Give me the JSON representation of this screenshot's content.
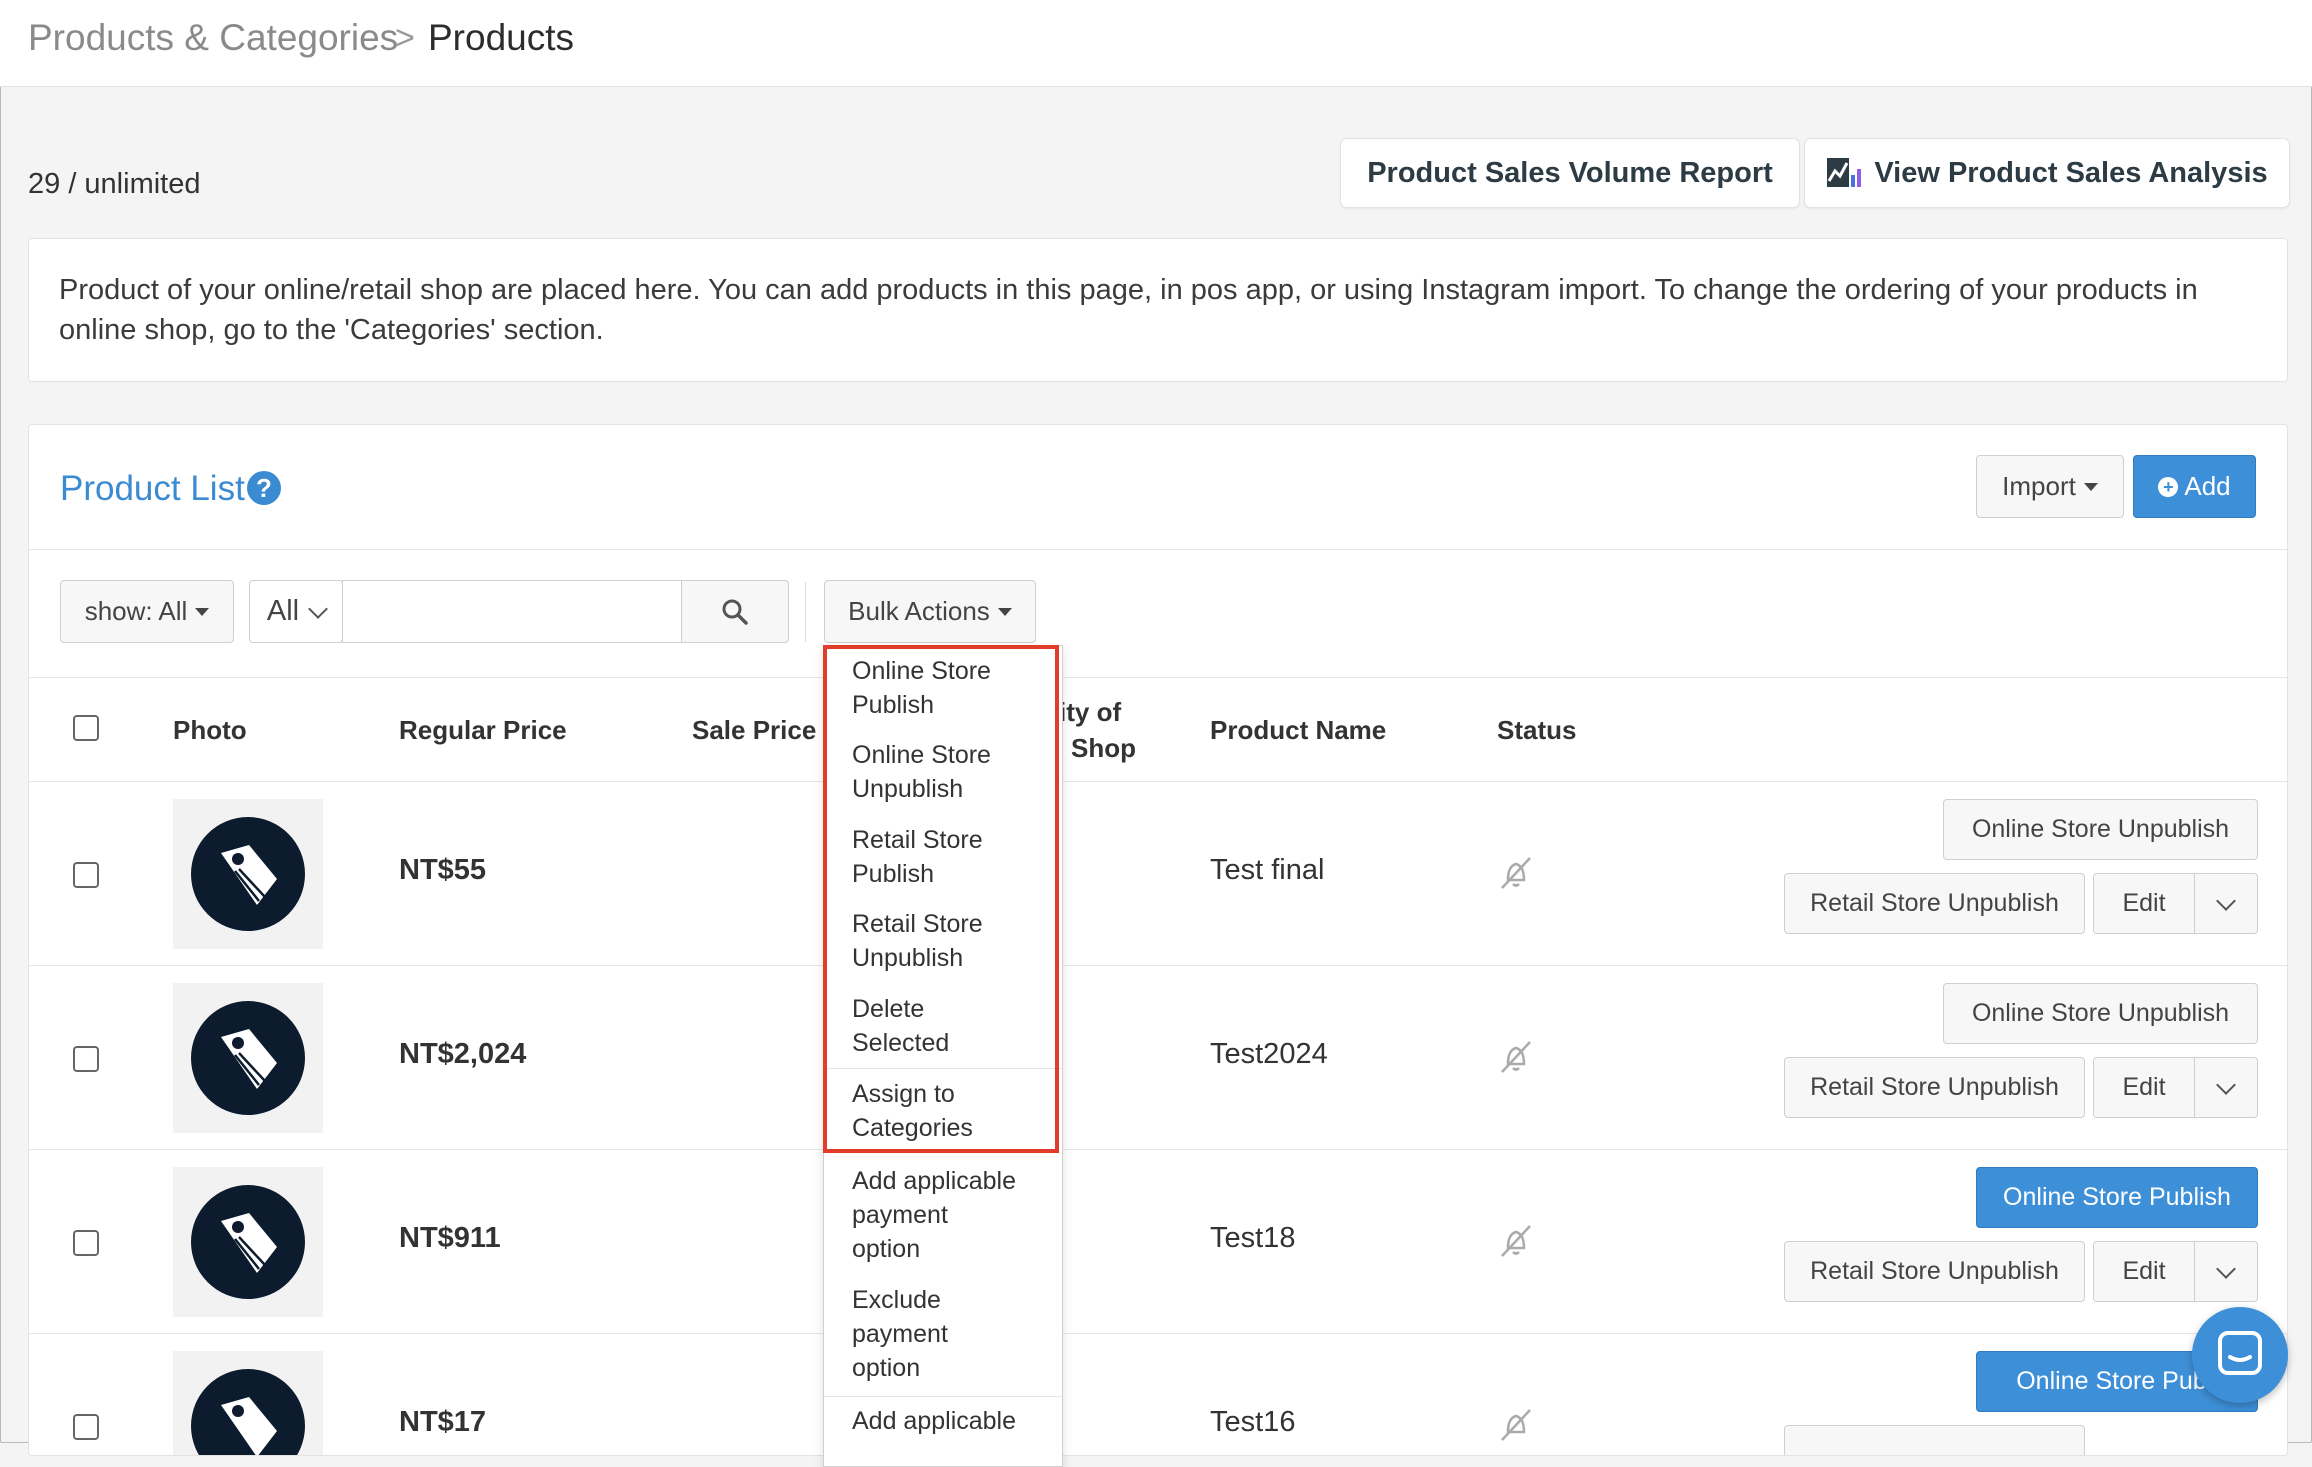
{
  "breadcrumb": {
    "parent": "Products & Categories",
    "separator": ">",
    "current": "Products"
  },
  "quota": "29 / unlimited",
  "top_buttons": {
    "report": "Product Sales Volume Report",
    "analysis": "View Product Sales Analysis"
  },
  "info": "Product of your online/retail shop are placed here. You can add products in this page, in pos app, or using Instagram import. To change the ordering of your products in online shop, go to the 'Categories' section.",
  "panel": {
    "title": "Product List",
    "help": "?",
    "import_label": "Import",
    "add_label": "Add"
  },
  "filters": {
    "show_label": "show: All",
    "type_value": "All",
    "search_value": "",
    "bulk_label": "Bulk Actions"
  },
  "table": {
    "headers": {
      "photo": "Photo",
      "regular_price": "Regular Price",
      "sale_price": "Sale Price",
      "quantity_partial_1": "ity of",
      "quantity_partial_2": "Shop",
      "product_name": "Product Name",
      "status": "Status"
    },
    "rows": [
      {
        "price": "NT$55",
        "name": "Test final",
        "btn_online": "Online Store Unpublish",
        "btn_retail": "Retail Store Unpublish",
        "btn_edit": "Edit"
      },
      {
        "price": "NT$2,024",
        "name": "Test2024",
        "btn_online": "Online Store Unpublish",
        "btn_retail": "Retail Store Unpublish",
        "btn_edit": "Edit"
      },
      {
        "price": "NT$911",
        "name": "Test18",
        "btn_online": "Online Store Publish",
        "btn_retail": "Retail Store Unpublish",
        "btn_edit": "Edit"
      },
      {
        "price": "NT$17",
        "name": "Test16",
        "btn_online": "Online Store Publi",
        "btn_retail": "",
        "btn_edit": ""
      }
    ]
  },
  "bulk_menu": [
    [
      "Online Store",
      "Publish"
    ],
    [
      "Online Store",
      "Unpublish"
    ],
    [
      "Retail Store",
      "Publish"
    ],
    [
      "Retail Store",
      "Unpublish"
    ],
    [
      "Delete",
      "Selected"
    ],
    [
      "Assign to",
      "Categories"
    ],
    [
      "Add applicable",
      "payment",
      "option"
    ],
    [
      "Exclude",
      "payment",
      "option"
    ],
    [
      "Add applicable"
    ]
  ],
  "colors": {
    "accent": "#3d8fd8",
    "highlight": "#e23d2a",
    "title_blue": "#3a8bd2"
  }
}
